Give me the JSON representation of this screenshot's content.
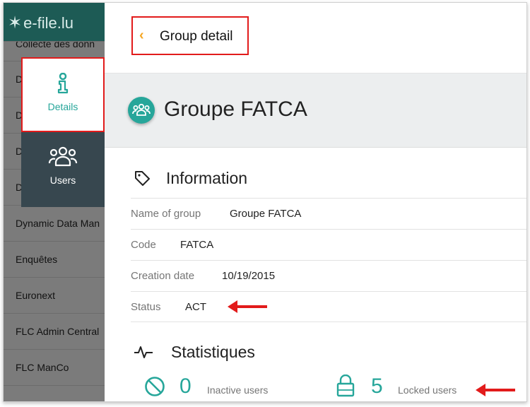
{
  "app": {
    "logo_text": "e-file.lu",
    "logo_icon": "efile-star-icon"
  },
  "background_list": {
    "items": [
      "Collecte des donn",
      "D",
      "D",
      "D",
      "D",
      "Dynamic Data Man",
      "Enquêtes",
      "Euronext",
      "FLC Admin Central",
      "FLC ManCo"
    ]
  },
  "tabs": [
    {
      "label": "Details",
      "icon": "person-info-icon",
      "active": true
    },
    {
      "label": "Users",
      "icon": "users-group-icon",
      "active": false
    }
  ],
  "header": {
    "back_icon": "chevron-left-icon",
    "title": "Group detail"
  },
  "group": {
    "icon": "group-avatar-icon",
    "name": "Groupe FATCA"
  },
  "information": {
    "title": "Information",
    "icon": "tag-icon",
    "rows": [
      {
        "label": "Name of group",
        "value": "Groupe FATCA"
      },
      {
        "label": "Code",
        "value": "FATCA"
      },
      {
        "label": "Creation date",
        "value": "10/19/2015"
      },
      {
        "label": "Status",
        "value": "ACT"
      }
    ]
  },
  "statistics": {
    "title": "Statistiques",
    "icon": "activity-icon",
    "inactive": {
      "icon": "ban-icon",
      "count": "0",
      "label": "Inactive users"
    },
    "locked": {
      "icon": "lock-icon",
      "count": "5",
      "label": "Locked users"
    }
  },
  "colors": {
    "accent": "#26a69a",
    "highlight_red": "#e21b1b",
    "back_chevron": "#f5a623",
    "dark_tab": "#37474f"
  }
}
